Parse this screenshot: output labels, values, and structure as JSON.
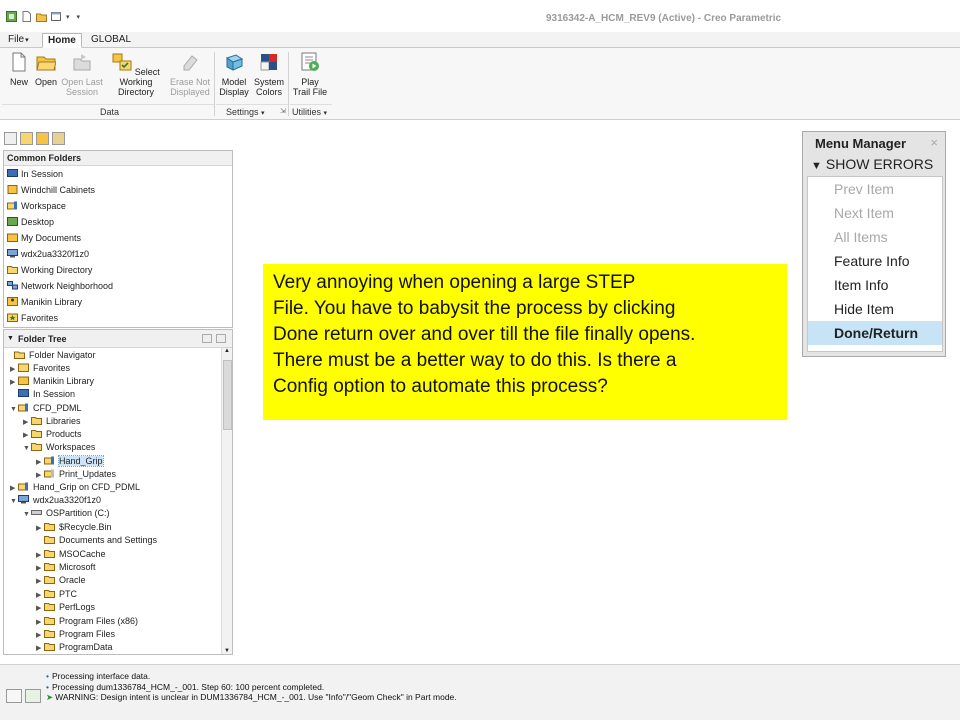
{
  "window": {
    "title": "9316342-A_HCM_REV9 (Active) - Creo Parametric"
  },
  "tabs": [
    {
      "label": "File",
      "suffix": "▾"
    },
    {
      "label": "Home"
    },
    {
      "label": "GLOBAL"
    }
  ],
  "ribbon": {
    "buttons": [
      {
        "line1": "New",
        "line2": "",
        "enabled": true,
        "icon": "new-document-icon"
      },
      {
        "line1": "Open",
        "line2": "",
        "enabled": true,
        "icon": "open-folder-icon"
      },
      {
        "line1": "Open Last",
        "line2": "Session",
        "enabled": false,
        "icon": "open-last-session-icon"
      },
      {
        "line1": "Select Working",
        "line2": "Directory",
        "enabled": true,
        "icon": "working-directory-icon"
      },
      {
        "line1": "Erase Not",
        "line2": "Displayed",
        "enabled": false,
        "icon": "erase-not-displayed-icon"
      },
      {
        "line1": "Model",
        "line2": "Display",
        "enabled": true,
        "icon": "model-display-icon"
      },
      {
        "line1": "System",
        "line2": "Colors",
        "enabled": true,
        "icon": "system-colors-icon"
      },
      {
        "line1": "Play",
        "line2": "Trail File",
        "enabled": true,
        "icon": "play-trail-file-icon"
      }
    ],
    "groups": {
      "data": "Data",
      "settings": "Settings",
      "settings_caret": "▾",
      "utilities": "Utilities",
      "utilities_caret": "▾"
    }
  },
  "common_folders": {
    "title": "Common Folders",
    "items": [
      "In Session",
      "Windchill Cabinets",
      "Workspace",
      "Desktop",
      "My Documents",
      "wdx2ua3320f1z0",
      "Working Directory",
      "Network Neighborhood",
      "Manikin Library",
      "Favorites"
    ]
  },
  "folder_tree": {
    "title": "Folder Tree",
    "items": [
      {
        "label": "Folder Navigator",
        "twisty": ""
      },
      {
        "label": "Favorites",
        "twisty": "▶"
      },
      {
        "label": "Manikin Library",
        "twisty": "▶"
      },
      {
        "label": "In Session",
        "twisty": ""
      },
      {
        "label": "CFD_PDML",
        "twisty": "▼"
      },
      {
        "label": "Libraries",
        "twisty": "▶"
      },
      {
        "label": "Products",
        "twisty": "▶"
      },
      {
        "label": "Workspaces",
        "twisty": "▼"
      },
      {
        "label": "Hand_Grip",
        "twisty": "▶"
      },
      {
        "label": "Print_Updates",
        "twisty": "▶"
      },
      {
        "label": "Hand_Grip on CFD_PDML",
        "twisty": "▶"
      },
      {
        "label": "wdx2ua3320f1z0",
        "twisty": "▼"
      },
      {
        "label": "OSPartition (C:)",
        "twisty": "▼"
      },
      {
        "label": "$Recycle.Bin",
        "twisty": "▶"
      },
      {
        "label": "Documents and Settings",
        "twisty": ""
      },
      {
        "label": "MSOCache",
        "twisty": "▶"
      },
      {
        "label": "Microsoft",
        "twisty": "▶"
      },
      {
        "label": "Oracle",
        "twisty": "▶"
      },
      {
        "label": "PTC",
        "twisty": "▶"
      },
      {
        "label": "PerfLogs",
        "twisty": "▶"
      },
      {
        "label": "Program Files (x86)",
        "twisty": "▶"
      },
      {
        "label": "Program Files",
        "twisty": "▶"
      },
      {
        "label": "ProgramData",
        "twisty": "▶"
      }
    ]
  },
  "menu_manager": {
    "title": "Menu Manager",
    "close": "×",
    "section": "SHOW ERRORS",
    "section_caret": "▼",
    "items": [
      {
        "label": "Prev Item",
        "enabled": false
      },
      {
        "label": "Next Item",
        "enabled": false
      },
      {
        "label": "All Items",
        "enabled": false
      },
      {
        "label": "Feature Info",
        "enabled": true
      },
      {
        "label": "Item Info",
        "enabled": true
      },
      {
        "label": "Hide Item",
        "enabled": true
      },
      {
        "label": "Done/Return",
        "enabled": true
      }
    ]
  },
  "annotation": {
    "lines": [
      "Very annoying when opening a large STEP",
      "File. You have to babysit the process by clicking",
      "Done return over and over till the file finally opens.",
      "There must be a better way to do this. Is there a",
      "Config option to automate this process?"
    ]
  },
  "status": {
    "messages": [
      {
        "bullet": "•",
        "text": "Processing interface data."
      },
      {
        "bullet": "•",
        "text": "Processing dum1336784_HCM_-_001. Step 60:  100 percent completed."
      },
      {
        "bullet": "➤",
        "text": "WARNING: Design intent is unclear in DUM1336784_HCM_-_001.  Use \"Info\"/\"Geom Check\" in Part mode."
      }
    ]
  },
  "colors": {
    "annotation_bg": "#ffff00",
    "menu_hot": "#c7e4f7",
    "selection": "#cce4f7"
  }
}
